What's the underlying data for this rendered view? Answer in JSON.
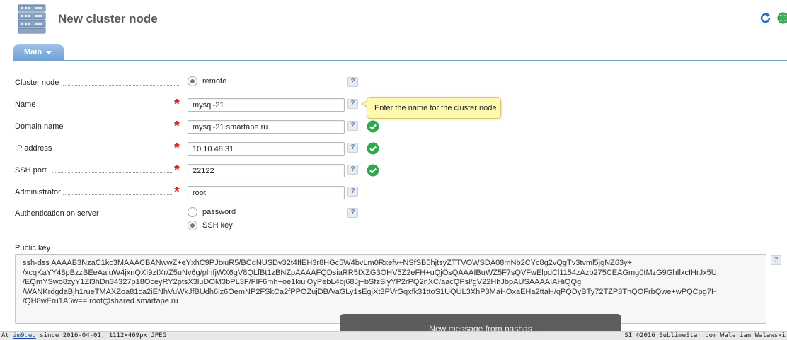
{
  "header": {
    "title": "New cluster node",
    "logo_icon": "server-rack-icon",
    "actions": [
      "refresh-icon",
      "globe-icon"
    ]
  },
  "tabs": [
    {
      "label": "Main",
      "active": true
    }
  ],
  "form": {
    "cluster_node": {
      "label": "Cluster node",
      "option": "remote",
      "selected": true,
      "help": "?"
    },
    "name": {
      "label": "Name",
      "value": "mysql-21",
      "required": true,
      "help": "?",
      "tooltip": "Enter the name for the cluster node"
    },
    "domain_name": {
      "label": "Domain name",
      "value": "mysql-21.smartape.ru",
      "required": true,
      "help": "?",
      "valid": true
    },
    "ip_address": {
      "label": "IP address",
      "value": "10.10.48.31",
      "required": true,
      "help": "?",
      "valid": true
    },
    "ssh_port": {
      "label": "SSH port",
      "value": "22122",
      "required": true,
      "help": "?",
      "valid": true
    },
    "administrator": {
      "label": "Administrator",
      "value": "root",
      "required": true,
      "help": "?"
    },
    "authentication": {
      "label": "Authentication on server",
      "options": [
        "password",
        "SSH key"
      ],
      "selected": "SSH key",
      "help": "?"
    },
    "public_key": {
      "label": "Public key",
      "help": "?",
      "lines": [
        "ssh-dss AAAAB3NzaC1kc3MAAACBANwwZ+eYxhC9PJtxuR5/BCdNUSDv32t4IfEH3r8HGc5W4bvLm0Rxefv+NSfSB5hjtsyZTTVOWSDA08mNb2CYc8g2vQgTv3tvml5jgNZ63y+",
        "/xcqKaYY48pBzzBEeAaluW4jxnQXI9zIXr/Z5uNv6g/plnfjWX6gV8QLfBt1zBNZpAAAAFQDsiaRR5IXZG3OHV5Z2eFH+uQjOsQAAAIBuWZ5F7sQVFwElpdCl1154zAzb275CEAGmg0tMzG9GhIlxcIHrJx5U",
        "/EQmYSwo8zyY1Zl3hDn34327p18OceyRY2ptsX3luDOM3bPL3F/FIF6mh+oe1kiulOyPebL4bj68Jj+bSfzSlyYP2rPQ2nXC/aacQPsl/gV22HhJbpAUSAAAAIAHiQQg",
        "/WANKrdgdaBjh1rueTMAXZoa81ca2iENhVuWkJfBUdh6lz6OemNP2FSkCa2fPPOZujDB/VaGLy1sEgjXt3PVrGqxfk31ttoS1UQUL3XhP3MaHOxaEHa2ttaH/qPQDyBTy72TZP8ThQOFrbQwe+wPQCpg7H",
        "/QH8wEru1A5w== root@shared.smartape.ru"
      ]
    }
  },
  "notification": {
    "text": "New message from pashas"
  },
  "bottombar": {
    "left_prefix": "At ",
    "left_link": "im9.eu",
    "left_suffix": " since 2016-04-01, 1112×469px JPEG",
    "right": "SI ©2016 SublimeStar.com Walerian Walawski"
  },
  "colors": {
    "accent": "#6d9fd4",
    "required": "#d22222",
    "valid": "#2fa84f",
    "tooltip_bg": "#fff9b0"
  }
}
